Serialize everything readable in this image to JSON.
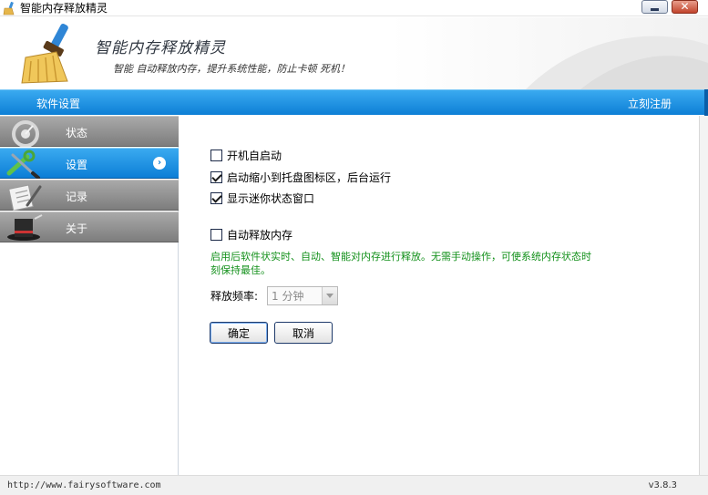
{
  "window": {
    "title": "智能内存释放精灵"
  },
  "header": {
    "app_name": "智能内存释放精灵",
    "slogan": "智能 自动释放内存，提升系统性能，防止卡顿 死机！"
  },
  "bluebar": {
    "section_title": "软件设置",
    "register_label": "立刻注册"
  },
  "sidebar": {
    "items": [
      {
        "label": "状态",
        "icon": "gauge-icon",
        "active": false
      },
      {
        "label": "设置",
        "icon": "wrench-screwdriver-icon",
        "active": true
      },
      {
        "label": "记录",
        "icon": "clipboard-pen-icon",
        "active": false
      },
      {
        "label": "关于",
        "icon": "magic-hat-icon",
        "active": false
      }
    ],
    "active_arrow": "›"
  },
  "settings": {
    "options": [
      {
        "label": "开机自启动",
        "checked": false
      },
      {
        "label": "启动缩小到托盘图标区，后台运行",
        "checked": true
      },
      {
        "label": "显示迷你状态窗口",
        "checked": true
      },
      {
        "label": "自动释放内存",
        "checked": false
      }
    ],
    "description": "启用后软件状实时、自动、智能对内存进行释放。无需手动操作，可使系统内存状态时刻保持最佳。",
    "frequency_label": "释放频率:",
    "frequency_value": "1 分钟",
    "ok_label": "确定",
    "cancel_label": "取消"
  },
  "status": {
    "url": "http://www.fairysoftware.com",
    "version": "v3.8.3"
  },
  "colors": {
    "accent_blue": "#1a8fe3",
    "nav_gray": "#8c8c8c",
    "desc_green": "#12901a"
  }
}
